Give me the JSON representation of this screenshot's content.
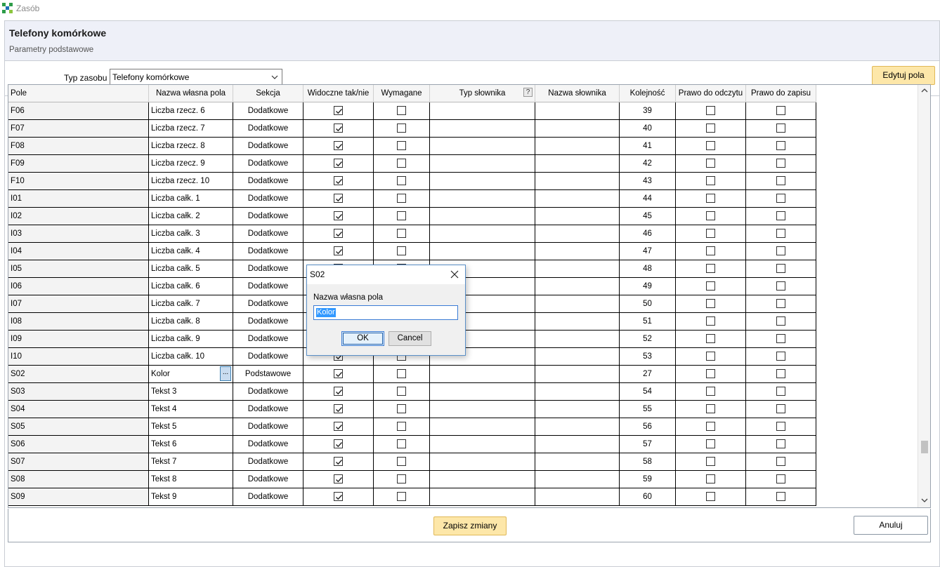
{
  "window": {
    "title": "Zasób"
  },
  "header": {
    "title": "Telefony komórkowe",
    "subtitle": "Parametry podstawowe"
  },
  "toolbar": {
    "type_label": "Typ zasobu",
    "type_value": "Telefony komórkowe",
    "edit_button": "Edytuj pola"
  },
  "grid": {
    "columns": [
      "Pole",
      "Nazwa własna pola",
      "Sekcja",
      "Widoczne tak/nie",
      "Wymagane",
      "Typ słownika",
      "Nazwa słownika",
      "Kolejność",
      "Prawo do odczytu",
      "Prawo do zapisu"
    ],
    "help_icon": "?",
    "rows": [
      {
        "pole": "F06",
        "name": "Liczba rzecz. 6",
        "section": "Dodatkowe",
        "visible": true,
        "required": false,
        "dict_type": "",
        "dict_name": "",
        "order": "39",
        "read": false,
        "write": false
      },
      {
        "pole": "F07",
        "name": "Liczba rzecz. 7",
        "section": "Dodatkowe",
        "visible": true,
        "required": false,
        "dict_type": "",
        "dict_name": "",
        "order": "40",
        "read": false,
        "write": false
      },
      {
        "pole": "F08",
        "name": "Liczba rzecz. 8",
        "section": "Dodatkowe",
        "visible": true,
        "required": false,
        "dict_type": "",
        "dict_name": "",
        "order": "41",
        "read": false,
        "write": false
      },
      {
        "pole": "F09",
        "name": "Liczba rzecz. 9",
        "section": "Dodatkowe",
        "visible": true,
        "required": false,
        "dict_type": "",
        "dict_name": "",
        "order": "42",
        "read": false,
        "write": false
      },
      {
        "pole": "F10",
        "name": "Liczba rzecz. 10",
        "section": "Dodatkowe",
        "visible": true,
        "required": false,
        "dict_type": "",
        "dict_name": "",
        "order": "43",
        "read": false,
        "write": false
      },
      {
        "pole": "I01",
        "name": "Liczba całk. 1",
        "section": "Dodatkowe",
        "visible": true,
        "required": false,
        "dict_type": "",
        "dict_name": "",
        "order": "44",
        "read": false,
        "write": false
      },
      {
        "pole": "I02",
        "name": "Liczba całk. 2",
        "section": "Dodatkowe",
        "visible": true,
        "required": false,
        "dict_type": "",
        "dict_name": "",
        "order": "45",
        "read": false,
        "write": false
      },
      {
        "pole": "I03",
        "name": "Liczba całk. 3",
        "section": "Dodatkowe",
        "visible": true,
        "required": false,
        "dict_type": "",
        "dict_name": "",
        "order": "46",
        "read": false,
        "write": false
      },
      {
        "pole": "I04",
        "name": "Liczba całk. 4",
        "section": "Dodatkowe",
        "visible": true,
        "required": false,
        "dict_type": "",
        "dict_name": "",
        "order": "47",
        "read": false,
        "write": false
      },
      {
        "pole": "I05",
        "name": "Liczba całk. 5",
        "section": "Dodatkowe",
        "visible": true,
        "required": false,
        "dict_type": "",
        "dict_name": "",
        "order": "48",
        "read": false,
        "write": false
      },
      {
        "pole": "I06",
        "name": "Liczba całk. 6",
        "section": "Dodatkowe",
        "visible": true,
        "required": false,
        "dict_type": "",
        "dict_name": "",
        "order": "49",
        "read": false,
        "write": false
      },
      {
        "pole": "I07",
        "name": "Liczba całk. 7",
        "section": "Dodatkowe",
        "visible": true,
        "required": false,
        "dict_type": "",
        "dict_name": "",
        "order": "50",
        "read": false,
        "write": false
      },
      {
        "pole": "I08",
        "name": "Liczba całk. 8",
        "section": "Dodatkowe",
        "visible": true,
        "required": false,
        "dict_type": "",
        "dict_name": "",
        "order": "51",
        "read": false,
        "write": false
      },
      {
        "pole": "I09",
        "name": "Liczba całk. 9",
        "section": "Dodatkowe",
        "visible": true,
        "required": false,
        "dict_type": "",
        "dict_name": "",
        "order": "52",
        "read": false,
        "write": false
      },
      {
        "pole": "I10",
        "name": "Liczba całk. 10",
        "section": "Dodatkowe",
        "visible": true,
        "required": false,
        "dict_type": "",
        "dict_name": "",
        "order": "53",
        "read": false,
        "write": false
      },
      {
        "pole": "S02",
        "name": "Kolor",
        "section": "Podstawowe",
        "visible": true,
        "required": false,
        "dict_type": "",
        "dict_name": "",
        "order": "27",
        "read": false,
        "write": false,
        "editing": true
      },
      {
        "pole": "S03",
        "name": "Tekst 3",
        "section": "Dodatkowe",
        "visible": true,
        "required": false,
        "dict_type": "",
        "dict_name": "",
        "order": "54",
        "read": false,
        "write": false
      },
      {
        "pole": "S04",
        "name": "Tekst 4",
        "section": "Dodatkowe",
        "visible": true,
        "required": false,
        "dict_type": "",
        "dict_name": "",
        "order": "55",
        "read": false,
        "write": false
      },
      {
        "pole": "S05",
        "name": "Tekst 5",
        "section": "Dodatkowe",
        "visible": true,
        "required": false,
        "dict_type": "",
        "dict_name": "",
        "order": "56",
        "read": false,
        "write": false
      },
      {
        "pole": "S06",
        "name": "Tekst 6",
        "section": "Dodatkowe",
        "visible": true,
        "required": false,
        "dict_type": "",
        "dict_name": "",
        "order": "57",
        "read": false,
        "write": false
      },
      {
        "pole": "S07",
        "name": "Tekst 7",
        "section": "Dodatkowe",
        "visible": true,
        "required": false,
        "dict_type": "",
        "dict_name": "",
        "order": "58",
        "read": false,
        "write": false
      },
      {
        "pole": "S08",
        "name": "Tekst 8",
        "section": "Dodatkowe",
        "visible": true,
        "required": false,
        "dict_type": "",
        "dict_name": "",
        "order": "59",
        "read": false,
        "write": false
      },
      {
        "pole": "S09",
        "name": "Tekst 9",
        "section": "Dodatkowe",
        "visible": true,
        "required": false,
        "dict_type": "",
        "dict_name": "",
        "order": "60",
        "read": false,
        "write": false
      }
    ],
    "ellipsis_label": "..."
  },
  "footer": {
    "save_button": "Zapisz zmiany",
    "cancel_button": "Anuluj"
  },
  "dialog": {
    "title": "S02",
    "label": "Nazwa własna pola",
    "value": "Kolor",
    "ok": "OK",
    "cancel": "Cancel"
  },
  "colors": {
    "accent_button": "#fde7a9",
    "header_bg": "#eef0f8",
    "selection": "#3399ff"
  }
}
